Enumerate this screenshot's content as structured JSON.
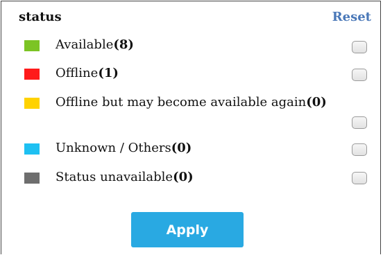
{
  "header": {
    "title": "status",
    "reset_label": "Reset"
  },
  "statuses": [
    {
      "name": "Available",
      "count": "(8)",
      "color": "#7cc424",
      "checked": false
    },
    {
      "name": "Offline",
      "count": "(1)",
      "color": "#ff1a1a",
      "checked": false
    },
    {
      "name": "Offline but may become available again",
      "count": "(0)",
      "color": "#ffd200",
      "checked": false
    },
    {
      "name": "Unknown / Others",
      "count": "(0)",
      "color": "#1ec0f2",
      "checked": false
    },
    {
      "name": "Status unavailable",
      "count": "(0)",
      "color": "#6e6e6e",
      "checked": false
    }
  ],
  "footer": {
    "apply_label": "Apply"
  }
}
